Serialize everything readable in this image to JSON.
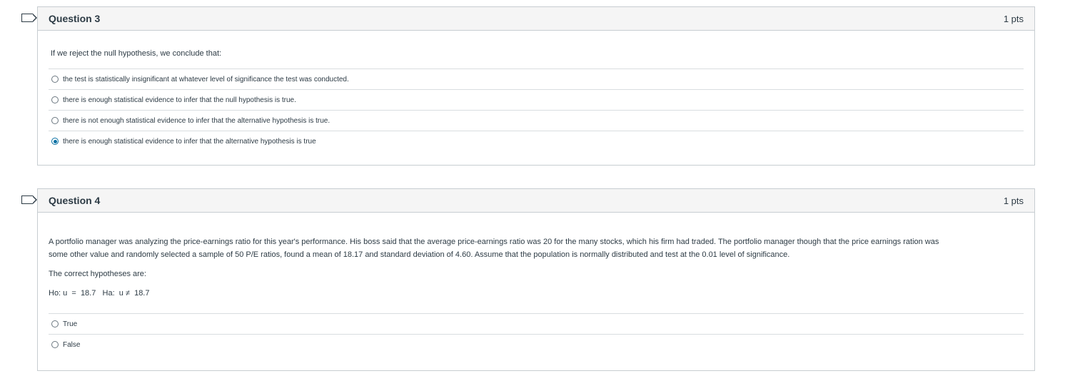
{
  "questions": [
    {
      "title": "Question 3",
      "points": "1 pts",
      "prompt": "If we reject the null hypothesis, we conclude that:",
      "answers": [
        {
          "label": "the test is statistically insignificant at whatever level of significance the test was conducted.",
          "selected": false
        },
        {
          "label": "there is enough statistical evidence to infer that the null hypothesis is true.",
          "selected": false
        },
        {
          "label": "there is not enough statistical evidence to infer that the alternative hypothesis is true.",
          "selected": false
        },
        {
          "label": "there is enough statistical evidence to infer that the alternative hypothesis is true",
          "selected": true
        }
      ]
    },
    {
      "title": "Question 4",
      "points": "1 pts",
      "prompt_line1": "A portfolio manager was analyzing the price-earnings ratio for this year's performance. His boss said that the average price-earnings ratio was 20 for the many stocks, which his firm had traded.  The portfolio manager though that the price earnings ration was",
      "prompt_line2": "some other value and randomly selected a sample of 50 P/E ratios,  found a mean of 18.17 and standard deviation of 4.60. Assume that the population is normally distributed and test at the 0.01 level of significance.",
      "prompt_sub": "The correct hypotheses are:",
      "hypotheses": "Ho: u  =  18.7   Ha:  u ≠  18.7",
      "answers": [
        {
          "label": "True",
          "selected": false
        },
        {
          "label": "False",
          "selected": false
        }
      ]
    }
  ],
  "colors": {
    "accent": "#0770a3",
    "border": "#c7cdd1",
    "header_bg": "#f5f5f5",
    "text": "#2d3b45"
  }
}
